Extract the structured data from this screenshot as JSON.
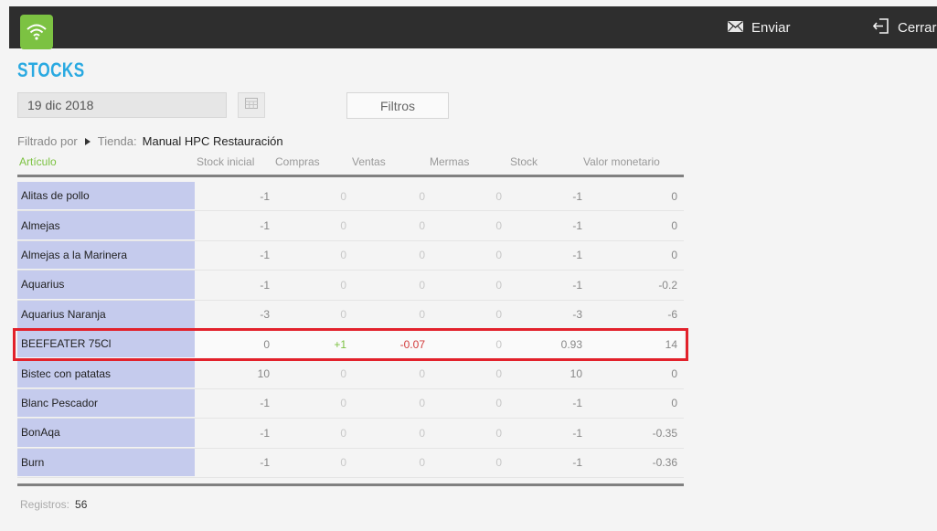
{
  "header": {
    "send_label": "Enviar",
    "close_label": "Cerrar",
    "colors": {
      "bar": "#2e2e2e",
      "wifi": "#7cc242"
    }
  },
  "page": {
    "title": "STOCKS",
    "date_value": "19 dic 2018",
    "filter_button": "Filtros",
    "filter_prefix": "Filtrado por",
    "filter_key": "Tienda:",
    "filter_value": "Manual HPC Restauración"
  },
  "table": {
    "columns": [
      "Artículo",
      "Stock inicial",
      "Compras",
      "Ventas",
      "Mermas",
      "Stock",
      "Valor monetario"
    ],
    "rows": [
      {
        "name": "Alitas de pollo",
        "stock_inicial": "-1",
        "compras": "0",
        "ventas": "0",
        "mermas": "0",
        "stock": "-1",
        "valor": "0"
      },
      {
        "name": "Almejas",
        "stock_inicial": "-1",
        "compras": "0",
        "ventas": "0",
        "mermas": "0",
        "stock": "-1",
        "valor": "0"
      },
      {
        "name": "Almejas a la Marinera",
        "stock_inicial": "-1",
        "compras": "0",
        "ventas": "0",
        "mermas": "0",
        "stock": "-1",
        "valor": "0"
      },
      {
        "name": "Aquarius",
        "stock_inicial": "-1",
        "compras": "0",
        "ventas": "0",
        "mermas": "0",
        "stock": "-1",
        "valor": "-0.2"
      },
      {
        "name": "Aquarius Naranja",
        "stock_inicial": "-3",
        "compras": "0",
        "ventas": "0",
        "mermas": "0",
        "stock": "-3",
        "valor": "-6"
      },
      {
        "name": "BEEFEATER 75Cl",
        "stock_inicial": "0",
        "compras": "+1",
        "ventas": "-0.07",
        "mermas": "0",
        "stock": "0.93",
        "valor": "14"
      },
      {
        "name": "Bistec con patatas",
        "stock_inicial": "10",
        "compras": "0",
        "ventas": "0",
        "mermas": "0",
        "stock": "10",
        "valor": "0"
      },
      {
        "name": "Blanc Pescador",
        "stock_inicial": "-1",
        "compras": "0",
        "ventas": "0",
        "mermas": "0",
        "stock": "-1",
        "valor": "0"
      },
      {
        "name": "BonAqa",
        "stock_inicial": "-1",
        "compras": "0",
        "ventas": "0",
        "mermas": "0",
        "stock": "-1",
        "valor": "-0.35"
      },
      {
        "name": "Burn",
        "stock_inicial": "-1",
        "compras": "0",
        "ventas": "0",
        "mermas": "0",
        "stock": "-1",
        "valor": "-0.36"
      }
    ]
  },
  "footer": {
    "records_label": "Registros:",
    "records_value": "56"
  },
  "colors": {
    "accent_title": "#29a9e1",
    "name_cell_bg": "#c5cbed",
    "highlight_border": "#e2212b",
    "positive": "#7cc242",
    "negative": "#d23c3c"
  }
}
